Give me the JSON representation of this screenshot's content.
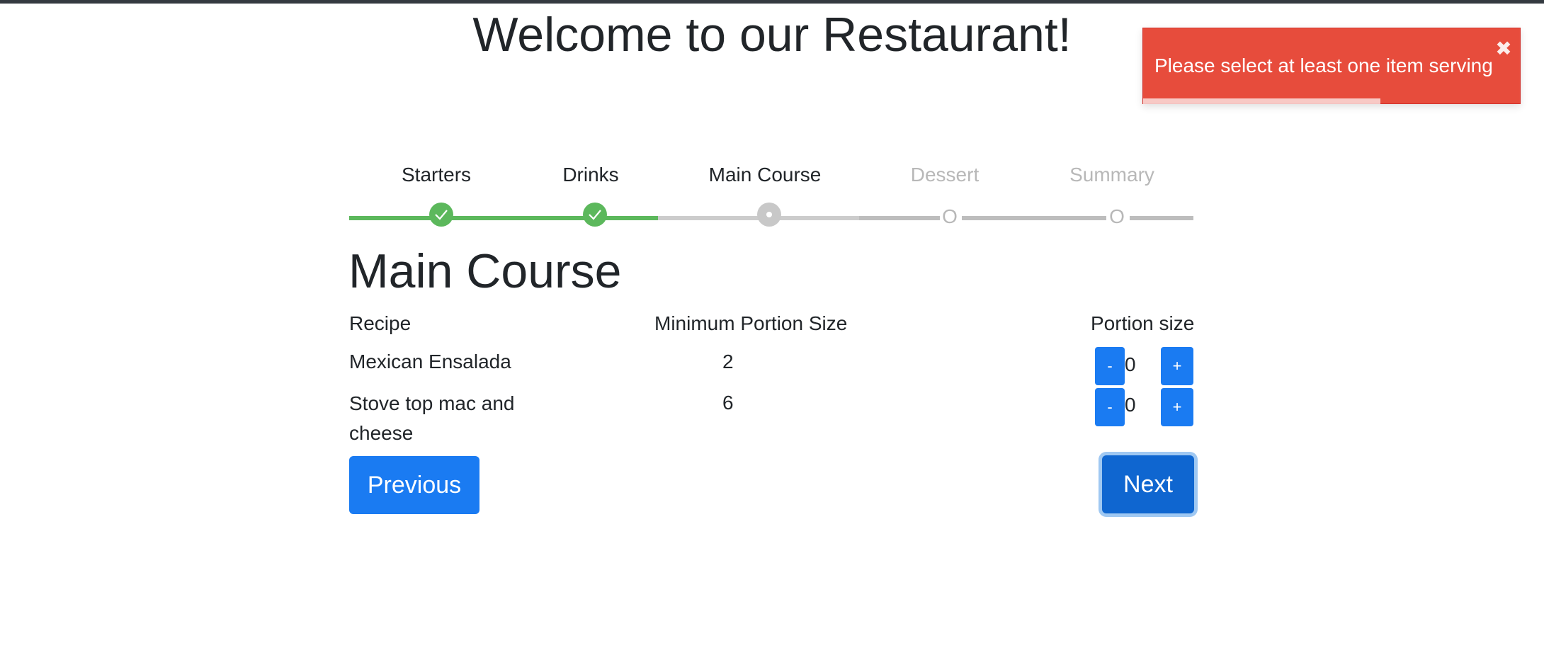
{
  "page": {
    "title": "Welcome to our Restaurant!"
  },
  "toast": {
    "message": "Please select at least one item serving",
    "close_icon": "close-icon",
    "progress": 0.63,
    "color": "#e74c3c"
  },
  "stepper": {
    "steps": [
      {
        "label": "Starters",
        "state": "done"
      },
      {
        "label": "Drinks",
        "state": "done"
      },
      {
        "label": "Main Course",
        "state": "active"
      },
      {
        "label": "Dessert",
        "state": "pending",
        "marker": "O"
      },
      {
        "label": "Summary",
        "state": "pending",
        "marker": "O"
      }
    ],
    "done_color": "#5cb85c"
  },
  "section": {
    "title": "Main Course",
    "columns": {
      "recipe": "Recipe",
      "min_portion": "Minimum Portion Size",
      "portion": "Portion size"
    },
    "rows": [
      {
        "recipe": "Mexican Ensalada",
        "min_portion": "2",
        "portion": "0"
      },
      {
        "recipe": "Stove top mac and cheese",
        "min_portion": "6",
        "portion": "0"
      }
    ],
    "minus_label": "-",
    "plus_label": "+"
  },
  "nav": {
    "previous": "Previous",
    "next": "Next"
  },
  "colors": {
    "primary": "#1a7bf2",
    "primary_active": "#0f66d0",
    "pending": "#b8b8b8"
  }
}
